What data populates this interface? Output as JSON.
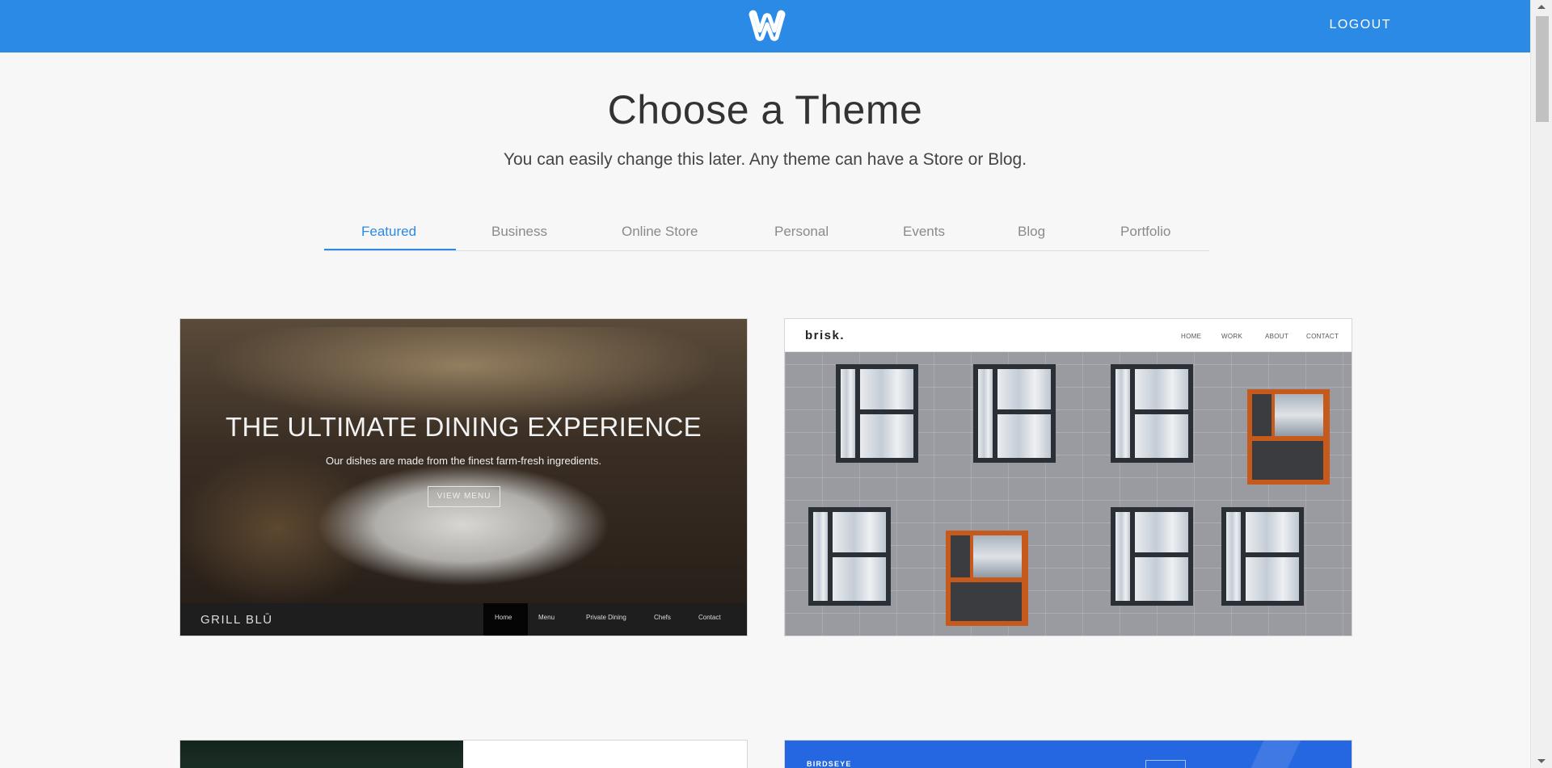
{
  "header": {
    "logo_icon": "weebly-w-logo-icon",
    "logout_label": "LOGOUT",
    "brand_color": "#2a8ae5"
  },
  "main": {
    "title": "Choose a Theme",
    "subtitle": "You can easily change this later. Any theme can have a Store or Blog."
  },
  "tabs": [
    {
      "label": "Featured",
      "active": true
    },
    {
      "label": "Business",
      "active": false
    },
    {
      "label": "Online Store",
      "active": false
    },
    {
      "label": "Personal",
      "active": false
    },
    {
      "label": "Events",
      "active": false
    },
    {
      "label": "Blog",
      "active": false
    },
    {
      "label": "Portfolio",
      "active": false
    }
  ],
  "themes": [
    {
      "name": "Grill Blu",
      "headline": "THE ULTIMATE DINING EXPERIENCE",
      "tagline": "Our dishes are made from the finest farm-fresh ingredients.",
      "cta": "VIEW MENU",
      "logo": "GRILL BLŪ",
      "nav": [
        "Home",
        "Menu",
        "Private Dining",
        "Chefs",
        "Contact"
      ]
    },
    {
      "name": "Brisk",
      "logo": "brisk.",
      "nav": [
        "HOME",
        "WORK",
        "ABOUT",
        "CONTACT"
      ]
    },
    {
      "name": ""
    },
    {
      "name": "Birdseye",
      "logo": "BIRDSEYE"
    }
  ]
}
